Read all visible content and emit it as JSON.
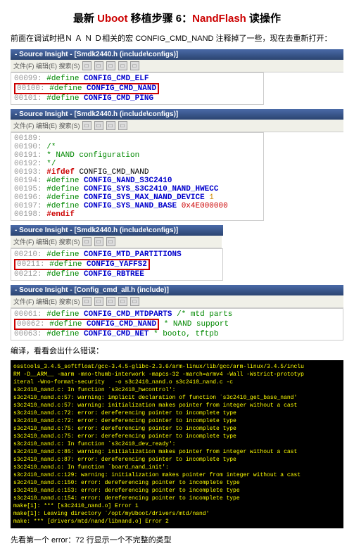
{
  "title_pre": "最新 ",
  "title_uboot": "Uboot",
  "title_mid": " 移植步骤  6：",
  "title_nand": "NandFlash",
  "title_post": " 读操作",
  "intro": "前面在调试时把Ｎ Ａ Ｎ Ｄ相关的宏 CONFIG_CMD_NAND 注释掉了一些，现在去重新打开：",
  "win1_title": "- Source Insight - [Smdk2440.h (include\\configs)]",
  "win1_menu": "文件(F) 编辑(E) 搜索(S)",
  "code1_l1_ln": "00099:",
  "code1_l1_def": "CONFIG_CMD_ELF",
  "code1_l2_ln": "00100:",
  "code1_l2_def": "CONFIG_CMD_NAND",
  "code1_l3_ln": "00101:",
  "code1_l3_def": "CONFIG_CMD_PING",
  "win2_title": "- Source Insight - [Smdk2440.h (include\\configs)]",
  "code2_l1_ln": "00189:",
  "code2_l2_ln": "00190:",
  "code2_l2_c": "/*",
  "code2_l3_ln": "00191:",
  "code2_l3_c": " * NAND configuration",
  "code2_l4_ln": "00192:",
  "code2_l4_c": " */",
  "code2_l5_ln": "00193:",
  "code2_l5_if": "#ifdef",
  "code2_l5_m": "CONFIG_CMD_NAND",
  "code2_l6_ln": "00194:",
  "code2_l6_m": "CONFIG_NAND_S3C2410",
  "code2_l7_ln": "00195:",
  "code2_l7_m": "CONFIG_SYS_S3C2410_NAND_HWECC",
  "code2_l8_ln": "00196:",
  "code2_l8_m": "CONFIG_SYS_MAX_NAND_DEVICE",
  "code2_l8_n": "1",
  "code2_l9_ln": "00197:",
  "code2_l9_m": "CONFIG_SYS_NAND_BASE",
  "code2_l9_h": "0x4E000000",
  "code2_l10_ln": "00198:",
  "code2_l10_e": "#endif",
  "win3_title": "- Source Insight - [Smdk2440.h (include\\configs)]",
  "code3_l1_ln": "00210:",
  "code3_l1_m": "CONFIG_MTD_PARTITIONS",
  "code3_l2_ln": "00211:",
  "code3_l2_m": "CONFIG_YAFFS2",
  "code3_l3_ln": "00212:",
  "code3_l3_m": "CONFIG_RBTREE",
  "win4_title": "- Source Insight - [Config_cmd_all.h (include)]",
  "code4_l1_ln": "00061:",
  "code4_l1_m": "CONFIG_CMD_MTDPARTS",
  "code4_l1_c": "/* mtd parts",
  "code4_l2_ln": "00062:",
  "code4_l2_m": "CONFIG_CMD_NAND",
  "code4_l2_c": "* NAND support",
  "code4_l3_ln": "00063:",
  "code4_l3_m": "CONFIG_CMD_NET",
  "code4_l3_c": "* booto, tftpb",
  "compile_text": "编译，看看会出什么错误：",
  "terminal_text": "osstools_3.4.5_softfloat/gcc-3.4.5-glibc-2.3.6/arm-linux/lib/gcc/arm-linux/3.4.5/inclu\nRM -D__ARM__ -marm -mno-thumb-interwork -mapcs-32 -march=armv4 -Wall -Wstrict-prototyp\niteral -Wno-format-security   -o s3c2410_nand.o s3c2410_nand.c -c\ns3c2410_nand.c: In function `s3c2410_hwcontrol':\ns3c2410_nand.c:57: warning: implicit declaration of function `s3c2410_get_base_nand'\ns3c2410_nand.c:57: warning: initialization makes pointer from integer without a cast\ns3c2410_nand.c:72: error: dereferencing pointer to incomplete type\ns3c2410_nand.c:72: error: dereferencing pointer to incomplete type\ns3c2410_nand.c:75: error: dereferencing pointer to incomplete type\ns3c2410_nand.c:75: error: dereferencing pointer to incomplete type\ns3c2410_nand.c: In function `s3c2410_dev_ready':\ns3c2410_nand.c:85: warning: initialization makes pointer from integer without a cast\ns3c2410_nand.c:87: error: dereferencing pointer to incomplete type\ns3c2410_nand.c: In function `board_nand_init':\ns3c2410_nand.c:129: warning: initialization makes pointer from integer without a cast\ns3c2410_nand.c:150: error: dereferencing pointer to incomplete type\ns3c2410_nand.c:153: error: dereferencing pointer to incomplete type\ns3c2410_nand.c:154: error: dereferencing pointer to incomplete type\nmake[1]: *** [s3c2410_nand.o] Error 1\nmake[1]: Leaving directory `/opt/myUboot/drivers/mtd/nand'\nmake: *** [drivers/mtd/nand/libnand.o] Error 2",
  "bottom_text": "先看第一个 error：72 行显示一个不完整的类型",
  "hash_define": "#define"
}
